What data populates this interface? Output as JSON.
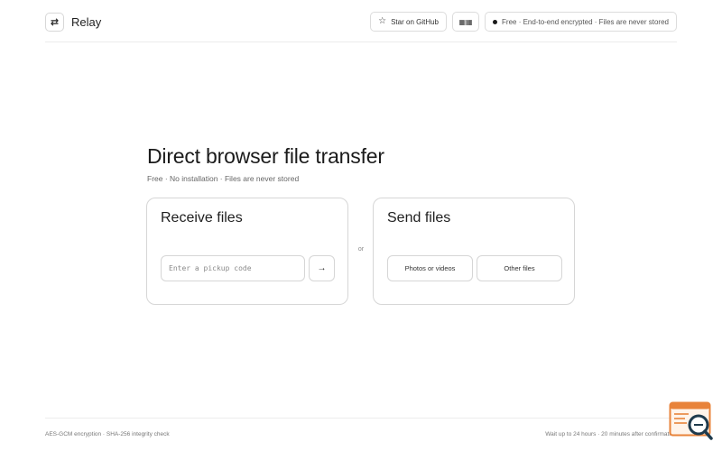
{
  "app": {
    "name": "Relay",
    "logo_glyph": "⇄"
  },
  "header": {
    "github_label": "Star on GitHub",
    "github_icon": "☆",
    "qr_glyph": "▦▦",
    "status_text": "Free · End-to-end encrypted · Files are never stored"
  },
  "hero": {
    "title": "Direct browser file transfer",
    "subtitle": "Free · No installation · Files are never stored"
  },
  "receive": {
    "title": "Receive files",
    "code_placeholder": "Enter a pickup code",
    "code_value": "",
    "submit_glyph": "→"
  },
  "separator": "or",
  "send": {
    "title": "Send files",
    "photos_label": "Photos or videos",
    "other_label": "Other files"
  },
  "footer": {
    "left": "AES-GCM encryption · SHA-256 integrity check",
    "right": "Wait up to 24 hours · 20 minutes after confirmation"
  },
  "colors": {
    "border": "#d6d6d6",
    "text": "#1f1f1f",
    "muted": "#666666",
    "widget_accent": "#e8833a",
    "widget_dark": "#1f3b4d"
  }
}
